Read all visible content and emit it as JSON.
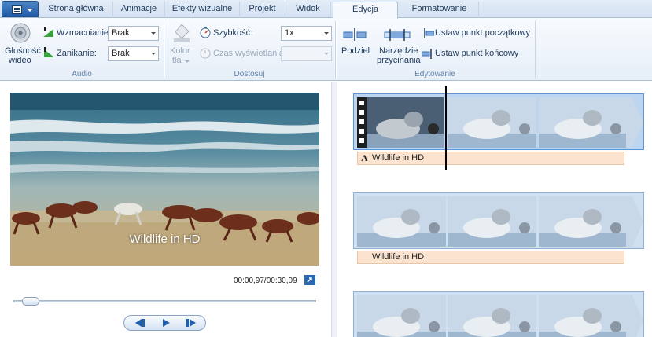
{
  "ribbon_tabs": [
    "Strona główna",
    "Animacje",
    "Efekty wizualne",
    "Projekt",
    "Widok",
    "Edycja",
    "Formatowanie"
  ],
  "active_tab": "Edycja",
  "audio": {
    "volume_label_1": "Głośność",
    "volume_label_2": "wideo",
    "fade_in_label": "Wzmacnianie:",
    "fade_in_value": "Brak",
    "fade_out_label": "Zanikanie:",
    "fade_out_value": "Brak",
    "group_label": "Audio"
  },
  "adjust": {
    "bg_color_label_1": "Kolor",
    "bg_color_label_2": "tła",
    "speed_label": "Szybkość:",
    "speed_value": "1x",
    "duration_label": "Czas wyświetlania:",
    "duration_value": "",
    "group_label": "Dostosuj"
  },
  "edit": {
    "split_label": "Podziel",
    "trim_label_1": "Narzędzie",
    "trim_label_2": "przycinania",
    "set_start_label": "Ustaw punkt początkowy",
    "set_end_label": "Ustaw punkt końcowy",
    "group_label": "Edytowanie"
  },
  "preview": {
    "caption": "Wildlife in HD",
    "timecode": "00:00,97/00:30,09",
    "seek_progress": 0.03
  },
  "storyboard": {
    "title_glyph": "A",
    "clips": [
      {
        "title": "Wildlife in HD"
      },
      {
        "title": "Wildlife in HD"
      },
      {
        "title": ""
      }
    ]
  },
  "colors": {
    "accent": "#2a6ab4",
    "ribbon_bg": "#e6eef8",
    "title_bar": "#fbe3cf",
    "clip_selected": "#bcd5f0"
  }
}
